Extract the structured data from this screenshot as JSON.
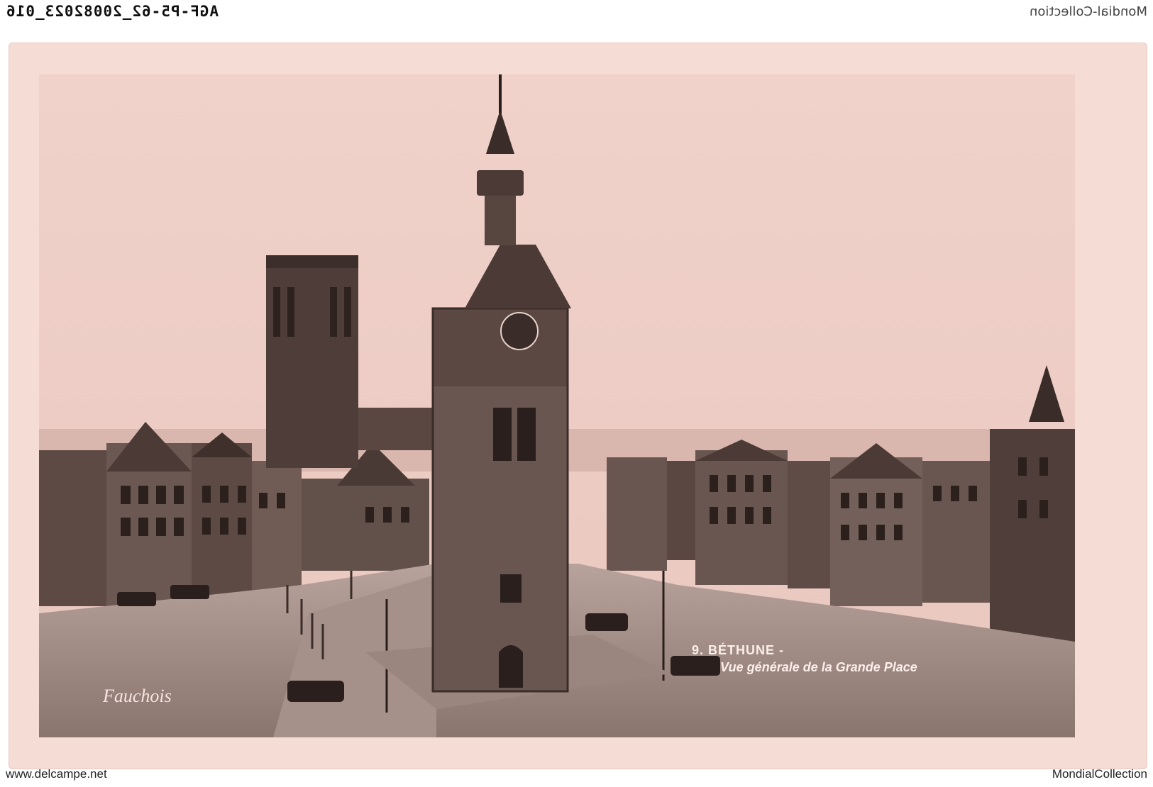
{
  "header": {
    "reference": "AGF-P5-62_20082023_016",
    "watermark": "Mondial-Collection"
  },
  "caption": {
    "number_title": "9. BÉTHUNE -",
    "subtitle": "Vue générale de la Grande Place"
  },
  "signature": "Fauchois",
  "footer": {
    "left": "www.delcampe.net",
    "right": "MondialCollection"
  },
  "colors": {
    "card": "#f5dcd4",
    "sky": "#f2d4cc",
    "ink": "#2a1f1c"
  }
}
